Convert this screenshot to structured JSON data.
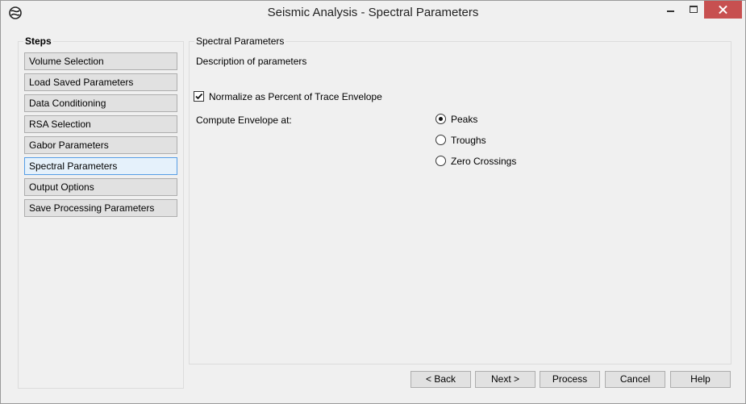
{
  "window": {
    "title": "Seismic Analysis - Spectral Parameters",
    "close_color": "#c75050"
  },
  "steps": {
    "legend": "Steps",
    "items": [
      {
        "label": "Volume Selection",
        "active": false
      },
      {
        "label": "Load Saved Parameters",
        "active": false
      },
      {
        "label": "Data Conditioning",
        "active": false
      },
      {
        "label": "RSA Selection",
        "active": false
      },
      {
        "label": "Gabor Parameters",
        "active": false
      },
      {
        "label": "Spectral Parameters",
        "active": true
      },
      {
        "label": "Output Options",
        "active": false
      },
      {
        "label": "Save Processing Parameters",
        "active": false
      }
    ]
  },
  "spectral": {
    "legend": "Spectral Parameters",
    "description": "Description of parameters",
    "normalize": {
      "label": "Normalize as Percent of Trace Envelope",
      "checked": true
    },
    "envelope_label": "Compute Envelope at:",
    "envelope_options": [
      {
        "label": "Peaks",
        "selected": true
      },
      {
        "label": "Troughs",
        "selected": false
      },
      {
        "label": "Zero Crossings",
        "selected": false
      }
    ]
  },
  "footer": {
    "back": "< Back",
    "next": "Next >",
    "process": "Process",
    "cancel": "Cancel",
    "help": "Help"
  }
}
